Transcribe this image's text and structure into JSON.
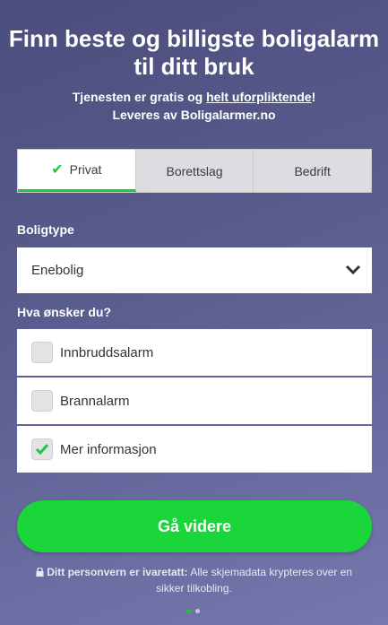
{
  "hero": {
    "title": "Finn beste og billigste boligalarm til ditt bruk",
    "sub_prefix": "Tjenesten er gratis og ",
    "sub_link": "helt uforpliktende",
    "sub_suffix": "!",
    "provider": "Leveres av Boligalarmer.no"
  },
  "tabs": [
    {
      "label": "Privat",
      "active": true
    },
    {
      "label": "Borettslag",
      "active": false
    },
    {
      "label": "Bedrift",
      "active": false
    }
  ],
  "form": {
    "boligtype_label": "Boligtype",
    "boligtype_value": "Enebolig",
    "wishes_label": "Hva ønsker du?",
    "options": [
      {
        "label": "Innbruddsalarm",
        "checked": false
      },
      {
        "label": "Brannalarm",
        "checked": false
      },
      {
        "label": "Mer informasjon",
        "checked": true
      }
    ],
    "submit_label": "Gå videre"
  },
  "privacy": {
    "bold": "Ditt personvern er ivaretatt:",
    "text": " Alle skjemadata krypteres over en sikker tilkobling."
  },
  "pagination": {
    "total": 2,
    "current": 1
  },
  "colors": {
    "accent": "#1bd63b",
    "background": "#5a5d8f"
  }
}
